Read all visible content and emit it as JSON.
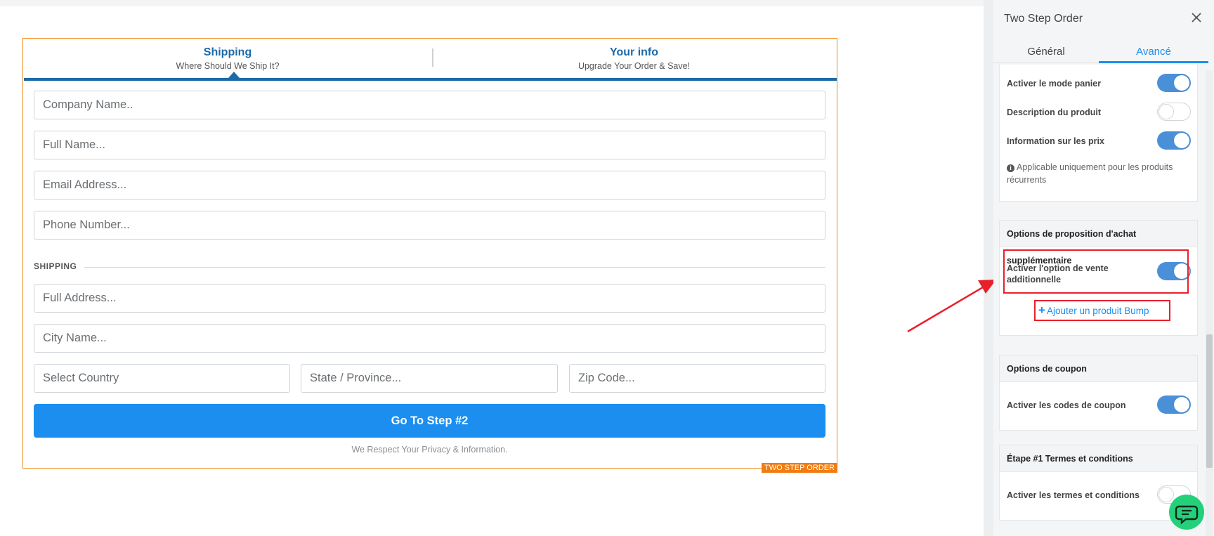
{
  "form": {
    "steps": [
      {
        "title": "Shipping",
        "subtitle": "Where Should We Ship It?"
      },
      {
        "title": "Your info",
        "subtitle": "Upgrade Your Order & Save!"
      }
    ],
    "fields": {
      "company": "Company Name..",
      "full_name": "Full Name...",
      "email": "Email Address...",
      "phone": "Phone Number...",
      "address": "Full Address...",
      "city": "City Name...",
      "country": "Select Country",
      "state": "State / Province...",
      "zip": "Zip Code..."
    },
    "section_label": "SHIPPING",
    "submit_label": "Go To Step #2",
    "privacy_text": "We Respect Your Privacy & Information.",
    "element_tag": "TWO STEP ORDER"
  },
  "panel": {
    "title": "Two Step Order",
    "tabs": [
      {
        "label": "Général",
        "active": false
      },
      {
        "label": "Avancé",
        "active": true
      }
    ],
    "general_settings": {
      "rows": [
        {
          "label": "Activer le mode panier",
          "enabled": true
        },
        {
          "label": "Description du produit",
          "enabled": false
        },
        {
          "label": "Information sur les prix",
          "enabled": true
        }
      ],
      "note": "Applicable uniquement pour les produits récurrents"
    },
    "bump_options": {
      "heading": "Options de proposition d'achat supplémentaire",
      "row": {
        "label": "Activer l'option de vente additionnelle",
        "enabled": true
      },
      "add_link": "Ajouter un produit Bump"
    },
    "coupon_options": {
      "heading": "Options de coupon",
      "row": {
        "label": "Activer les codes de coupon",
        "enabled": true
      }
    },
    "terms_options": {
      "heading": "Étape #1 Termes et conditions",
      "row": {
        "label": "Activer les termes et conditions",
        "enabled": false
      }
    }
  },
  "colors": {
    "accent": "#1b8ef0",
    "step_blue": "#1c6aa8",
    "toggle_on": "#4a90d9",
    "annotation_red": "#e8202a",
    "element_border": "#f08c1c",
    "chat_green": "#24d07a"
  },
  "icons": [
    "close-icon",
    "info-icon",
    "plus-icon",
    "chat-icon",
    "caret-up-icon"
  ]
}
